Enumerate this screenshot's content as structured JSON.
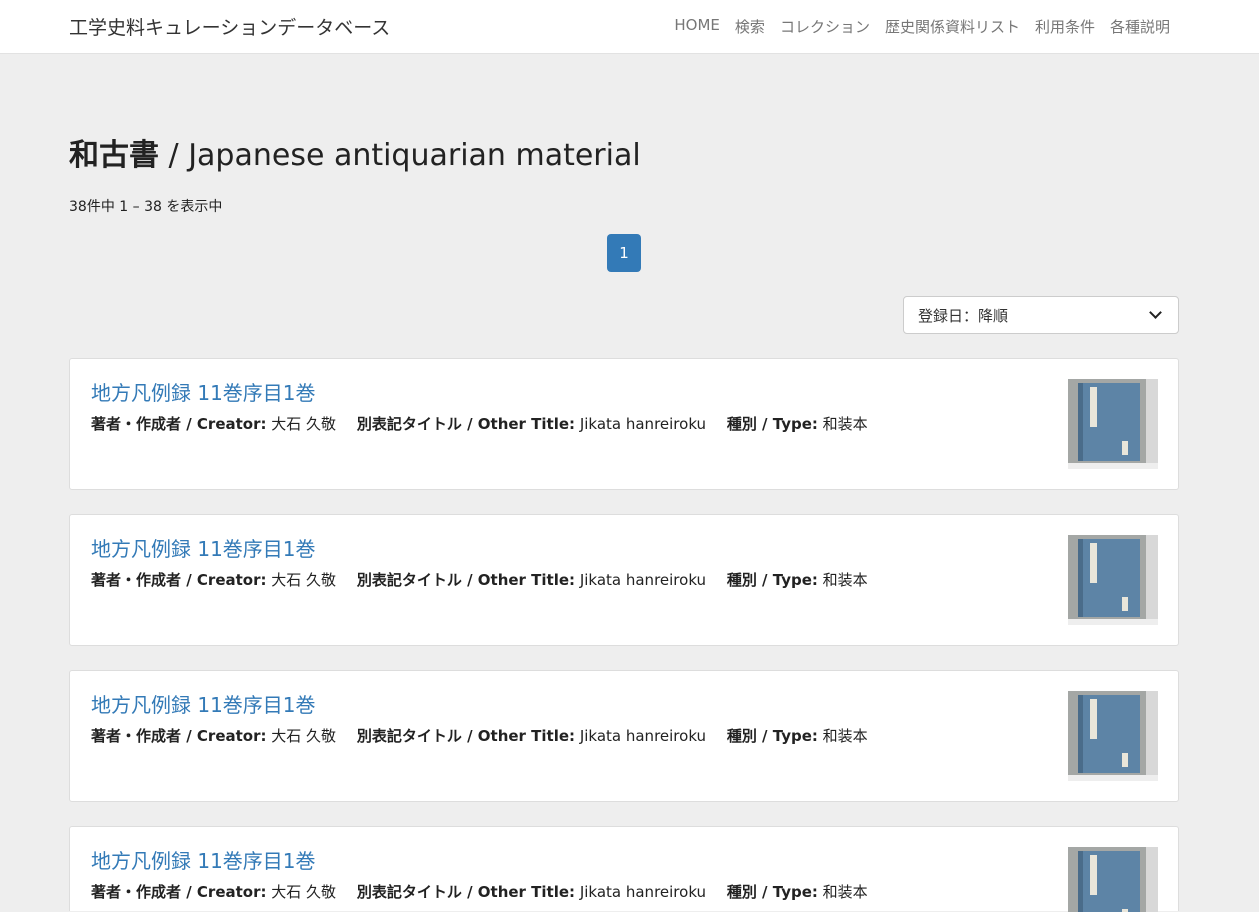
{
  "header": {
    "brand": "工学史料キュレーションデータベース",
    "nav": [
      "HOME",
      "検索",
      "コレクション",
      "歴史関係資料リスト",
      "利用条件",
      "各種説明"
    ]
  },
  "page": {
    "title_ja": "和古書",
    "title_sep": " / ",
    "title_en": "Japanese antiquarian material",
    "result_count": "38件中 1 – 38 を表示中",
    "current_page": "1",
    "sort_value": "登録日：降順"
  },
  "results": [
    {
      "title": "地方凡例録 11巻序目1巻",
      "creator_label": "著者・作成者 / Creator:",
      "creator": "大石 久敬",
      "other_title_label": "別表記タイトル / Other Title:",
      "other_title": "Jikata hanreiroku",
      "type_label": "種別 / Type:",
      "type": "和装本"
    },
    {
      "title": "地方凡例録 11巻序目1巻",
      "creator_label": "著者・作成者 / Creator:",
      "creator": "大石 久敬",
      "other_title_label": "別表記タイトル / Other Title:",
      "other_title": "Jikata hanreiroku",
      "type_label": "種別 / Type:",
      "type": "和装本"
    },
    {
      "title": "地方凡例録 11巻序目1巻",
      "creator_label": "著者・作成者 / Creator:",
      "creator": "大石 久敬",
      "other_title_label": "別表記タイトル / Other Title:",
      "other_title": "Jikata hanreiroku",
      "type_label": "種別 / Type:",
      "type": "和装本"
    },
    {
      "title": "地方凡例録 11巻序目1巻",
      "creator_label": "著者・作成者 / Creator:",
      "creator": "大石 久敬",
      "other_title_label": "別表記タイトル / Other Title:",
      "other_title": "Jikata hanreiroku",
      "type_label": "種別 / Type:",
      "type": "和装本"
    }
  ],
  "colors": {
    "link": "#337ab7",
    "background": "#eeeeee",
    "book_cover": "#5d84a6"
  }
}
